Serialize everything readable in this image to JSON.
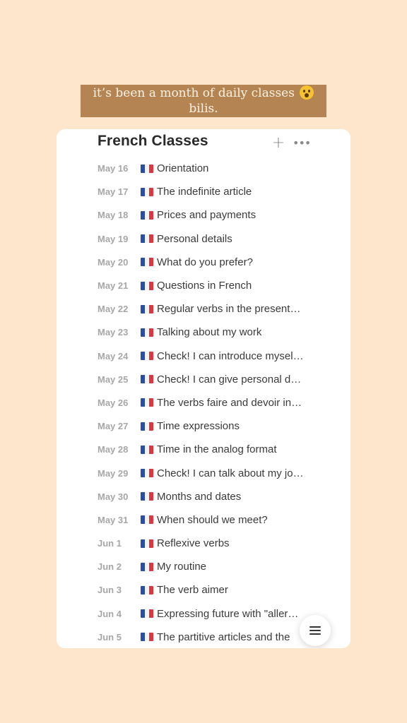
{
  "caption": {
    "line1": "it’s been a month of daily classes",
    "line2": "bilis.",
    "emoji_icon": "astonished-face-emoji"
  },
  "page": {
    "title": "French Classes",
    "add_icon": "plus-icon",
    "more_icon": "more-horizontal-icon",
    "menu_icon": "hamburger-menu-icon",
    "back_icon": "chevron-left-icon"
  },
  "colors": {
    "background": "#fde6cb",
    "caption_bg": "#b48552",
    "flag_blue": "#2a4ea3",
    "flag_red": "#e0343e"
  },
  "classes": [
    {
      "date": "May 16",
      "flag_icon": "french-flag-icon",
      "title": "Orientation"
    },
    {
      "date": "May 17",
      "flag_icon": "french-flag-icon",
      "title": "The indefinite article"
    },
    {
      "date": "May 18",
      "flag_icon": "french-flag-icon",
      "title": "Prices and payments"
    },
    {
      "date": "May 19",
      "flag_icon": "french-flag-icon",
      "title": "Personal details"
    },
    {
      "date": "May 20",
      "flag_icon": "french-flag-icon",
      "title": "What do you prefer?"
    },
    {
      "date": "May 21",
      "flag_icon": "french-flag-icon",
      "title": "Questions in French"
    },
    {
      "date": "May 22",
      "flag_icon": "french-flag-icon",
      "title": "Regular verbs in the present…"
    },
    {
      "date": "May 23",
      "flag_icon": "french-flag-icon",
      "title": "Talking about my work"
    },
    {
      "date": "May 24",
      "flag_icon": "french-flag-icon",
      "title": "Check! I can introduce mysel…"
    },
    {
      "date": "May 25",
      "flag_icon": "french-flag-icon",
      "title": "Check! I can give personal d…"
    },
    {
      "date": "May 26",
      "flag_icon": "french-flag-icon",
      "title": "The verbs faire and devoir in…"
    },
    {
      "date": "May 27",
      "flag_icon": "french-flag-icon",
      "title": "Time expressions"
    },
    {
      "date": "May 28",
      "flag_icon": "french-flag-icon",
      "title": "Time in the analog format"
    },
    {
      "date": "May 29",
      "flag_icon": "french-flag-icon",
      "title": "Check! I can talk about my jo…"
    },
    {
      "date": "May 30",
      "flag_icon": "french-flag-icon",
      "title": "Months and dates"
    },
    {
      "date": "May 31",
      "flag_icon": "french-flag-icon",
      "title": "When should we meet?"
    },
    {
      "date": "Jun 1",
      "flag_icon": "french-flag-icon",
      "title": "Reflexive verbs"
    },
    {
      "date": "Jun 2",
      "flag_icon": "french-flag-icon",
      "title": "My routine"
    },
    {
      "date": "Jun 3",
      "flag_icon": "french-flag-icon",
      "title": "The verb aimer"
    },
    {
      "date": "Jun 4",
      "flag_icon": "french-flag-icon",
      "title": "Expressing future with \"aller…"
    },
    {
      "date": "Jun 5",
      "flag_icon": "french-flag-icon",
      "title": "The partitive articles and the"
    }
  ]
}
